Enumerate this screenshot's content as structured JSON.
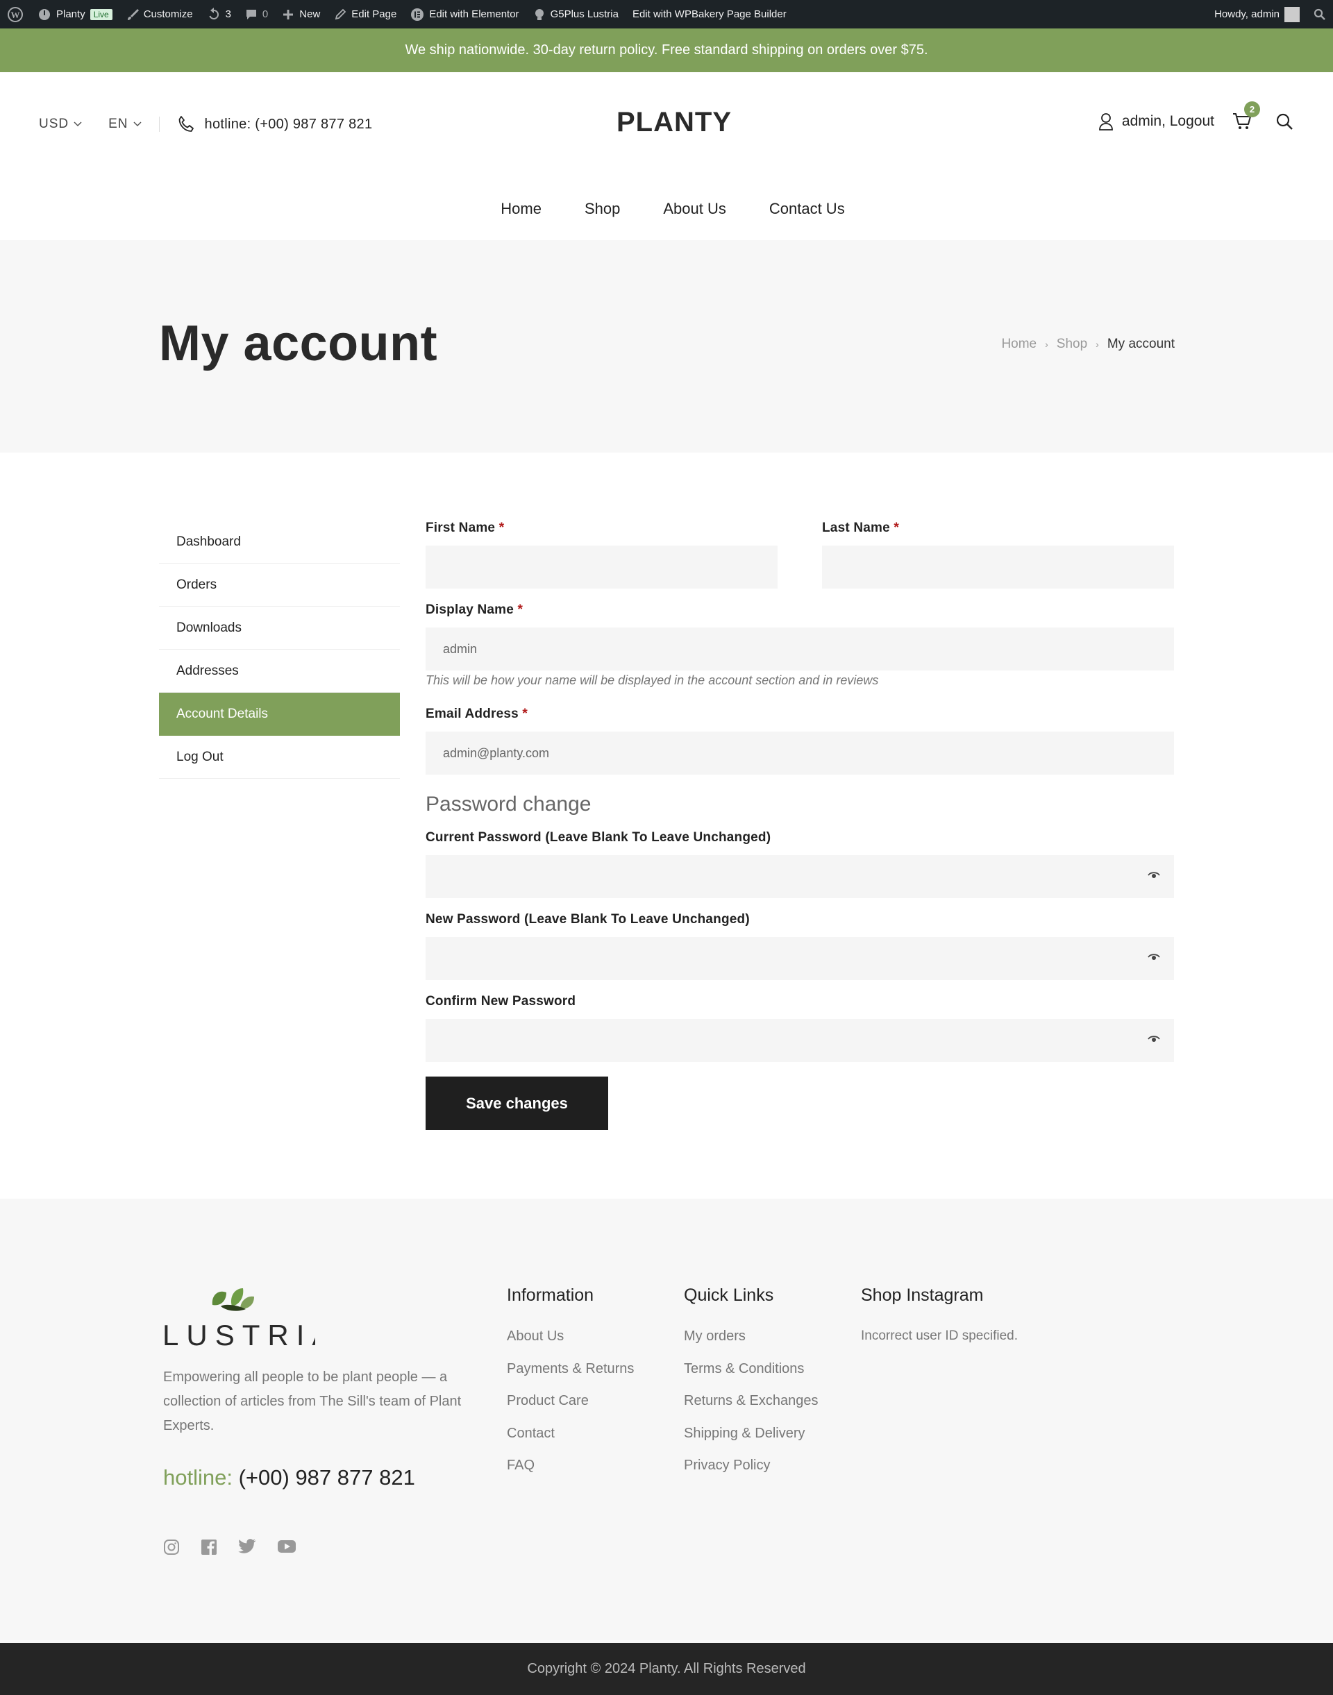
{
  "admin_bar": {
    "site_name": "Planty",
    "live_badge": "Live",
    "customize": "Customize",
    "updates_count": "3",
    "comments_count": "0",
    "new": "New",
    "edit_page": "Edit Page",
    "edit_elementor": "Edit with Elementor",
    "theme": "G5Plus Lustria",
    "edit_wpbakery": "Edit with WPBakery Page Builder",
    "howdy": "Howdy, admin"
  },
  "promo_text": "We ship nationwide. 30-day return policy. Free standard shipping on orders over $75.",
  "header": {
    "currency": "USD",
    "language": "EN",
    "hotline": "hotline: (+00) 987 877 821",
    "logo": "PLANTY",
    "user_link": "admin, Logout",
    "cart_count": "2"
  },
  "nav": [
    "Home",
    "Shop",
    "About Us",
    "Contact Us"
  ],
  "page_title": "My account",
  "breadcrumbs": [
    "Home",
    "Shop",
    "My account"
  ],
  "sidebar": [
    {
      "label": "Dashboard",
      "active": false
    },
    {
      "label": "Orders",
      "active": false
    },
    {
      "label": "Downloads",
      "active": false
    },
    {
      "label": "Addresses",
      "active": false
    },
    {
      "label": "Account Details",
      "active": true
    },
    {
      "label": "Log Out",
      "active": false
    }
  ],
  "form": {
    "first_name_label": "First Name",
    "first_name_value": "",
    "last_name_label": "Last Name",
    "last_name_value": "",
    "display_name_label": "Display Name",
    "display_name_value": "admin",
    "display_name_hint": "This will be how your name will be displayed in the account section and in reviews",
    "email_label": "Email Address",
    "email_value": "admin@planty.com",
    "required_mark": "*",
    "password_section_title": "Password change",
    "current_password_label": "Current Password (Leave Blank To Leave Unchanged)",
    "new_password_label": "New Password (Leave Blank To Leave Unchanged)",
    "confirm_password_label": "Confirm New Password",
    "save_button": "Save changes"
  },
  "footer": {
    "logo_text": "LUSTRIA",
    "description": "Empowering all people to be plant people — a collection of articles from The Sill's team of Plant Experts.",
    "hotline_label": "hotline:",
    "hotline_number": "(+00) 987 877 821",
    "information": {
      "title": "Information",
      "links": [
        "About Us",
        "Payments & Returns",
        "Product Care",
        "Contact",
        "FAQ"
      ]
    },
    "quick_links": {
      "title": "Quick Links",
      "links": [
        "My orders",
        "Terms & Conditions",
        "Returns & Exchanges",
        "Shipping & Delivery",
        "Privacy Policy"
      ]
    },
    "instagram": {
      "title": "Shop Instagram",
      "text": "Incorrect user ID specified."
    },
    "social_icons": [
      "instagram-icon",
      "facebook-icon",
      "twitter-icon",
      "youtube-icon"
    ],
    "copyright": "Copyright © 2024 Planty. All Rights Reserved"
  },
  "colors": {
    "accent": "#80a05a",
    "admin_bar": "#1d2327",
    "dark_button": "#1f1f1f",
    "footer_bg": "#f7f7f7",
    "copyright_bg": "#252525",
    "required": "#b11b1b"
  }
}
